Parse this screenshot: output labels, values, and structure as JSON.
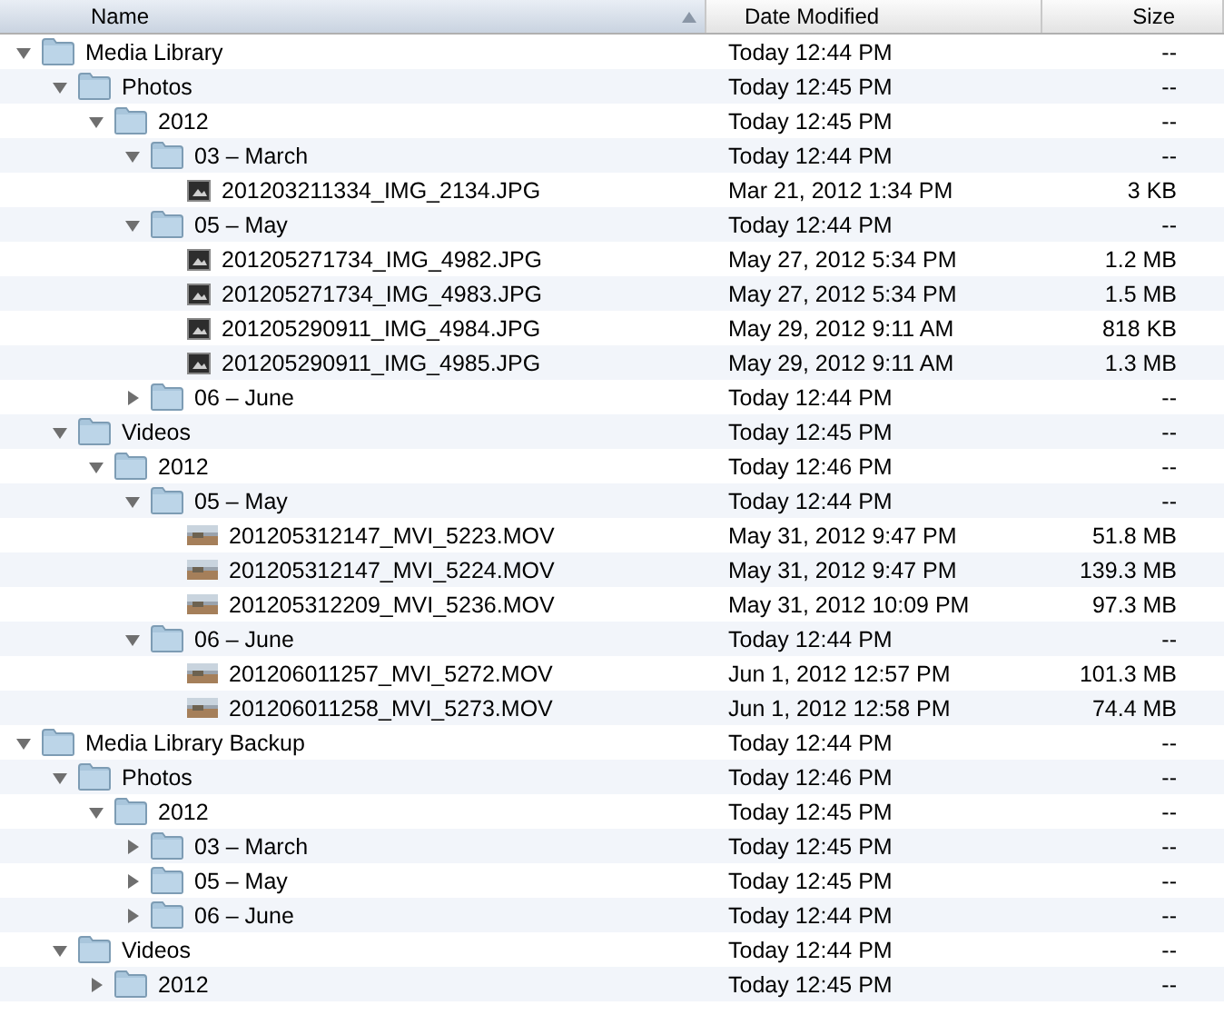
{
  "columns": [
    {
      "label": "Name",
      "selected": true,
      "sort_ascending": true
    },
    {
      "label": "Date Modified",
      "selected": false
    },
    {
      "label": "Size",
      "selected": false
    }
  ],
  "items": [
    {
      "name": "Media Library",
      "kind": "folder",
      "date": "Today 12:44 PM",
      "size": "--",
      "expanded": true,
      "children": [
        {
          "name": "Photos",
          "kind": "folder",
          "date": "Today 12:45 PM",
          "size": "--",
          "expanded": true,
          "children": [
            {
              "name": "2012",
              "kind": "folder",
              "date": "Today 12:45 PM",
              "size": "--",
              "expanded": true,
              "children": [
                {
                  "name": "03 – March",
                  "kind": "folder",
                  "date": "Today 12:44 PM",
                  "size": "--",
                  "expanded": true,
                  "children": [
                    {
                      "name": "201203211334_IMG_2134.JPG",
                      "kind": "image",
                      "date": "Mar 21, 2012 1:34 PM",
                      "size": "3 KB"
                    }
                  ]
                },
                {
                  "name": "05 – May",
                  "kind": "folder",
                  "date": "Today 12:44 PM",
                  "size": "--",
                  "expanded": true,
                  "children": [
                    {
                      "name": "201205271734_IMG_4982.JPG",
                      "kind": "image",
                      "date": "May 27, 2012 5:34 PM",
                      "size": "1.2 MB"
                    },
                    {
                      "name": "201205271734_IMG_4983.JPG",
                      "kind": "image",
                      "date": "May 27, 2012 5:34 PM",
                      "size": "1.5 MB"
                    },
                    {
                      "name": "201205290911_IMG_4984.JPG",
                      "kind": "image",
                      "date": "May 29, 2012 9:11 AM",
                      "size": "818 KB"
                    },
                    {
                      "name": "201205290911_IMG_4985.JPG",
                      "kind": "image",
                      "date": "May 29, 2012 9:11 AM",
                      "size": "1.3 MB"
                    }
                  ]
                },
                {
                  "name": "06 – June",
                  "kind": "folder",
                  "date": "Today 12:44 PM",
                  "size": "--",
                  "expanded": false
                }
              ]
            }
          ]
        },
        {
          "name": "Videos",
          "kind": "folder",
          "date": "Today 12:45 PM",
          "size": "--",
          "expanded": true,
          "children": [
            {
              "name": "2012",
              "kind": "folder",
              "date": "Today 12:46 PM",
              "size": "--",
              "expanded": true,
              "children": [
                {
                  "name": "05 – May",
                  "kind": "folder",
                  "date": "Today 12:44 PM",
                  "size": "--",
                  "expanded": true,
                  "children": [
                    {
                      "name": "201205312147_MVI_5223.MOV",
                      "kind": "video",
                      "date": "May 31, 2012 9:47 PM",
                      "size": "51.8 MB"
                    },
                    {
                      "name": "201205312147_MVI_5224.MOV",
                      "kind": "video",
                      "date": "May 31, 2012 9:47 PM",
                      "size": "139.3 MB"
                    },
                    {
                      "name": "201205312209_MVI_5236.MOV",
                      "kind": "video",
                      "date": "May 31, 2012 10:09 PM",
                      "size": "97.3 MB"
                    }
                  ]
                },
                {
                  "name": "06 – June",
                  "kind": "folder",
                  "date": "Today 12:44 PM",
                  "size": "--",
                  "expanded": true,
                  "children": [
                    {
                      "name": "201206011257_MVI_5272.MOV",
                      "kind": "video",
                      "date": "Jun 1, 2012 12:57 PM",
                      "size": "101.3 MB"
                    },
                    {
                      "name": "201206011258_MVI_5273.MOV",
                      "kind": "video",
                      "date": "Jun 1, 2012 12:58 PM",
                      "size": "74.4 MB"
                    }
                  ]
                }
              ]
            }
          ]
        }
      ]
    },
    {
      "name": "Media Library Backup",
      "kind": "folder",
      "date": "Today 12:44 PM",
      "size": "--",
      "expanded": true,
      "children": [
        {
          "name": "Photos",
          "kind": "folder",
          "date": "Today 12:46 PM",
          "size": "--",
          "expanded": true,
          "children": [
            {
              "name": "2012",
              "kind": "folder",
              "date": "Today 12:45 PM",
              "size": "--",
              "expanded": true,
              "children": [
                {
                  "name": "03 – March",
                  "kind": "folder",
                  "date": "Today 12:45 PM",
                  "size": "--",
                  "expanded": false
                },
                {
                  "name": "05 – May",
                  "kind": "folder",
                  "date": "Today 12:45 PM",
                  "size": "--",
                  "expanded": false
                },
                {
                  "name": "06 – June",
                  "kind": "folder",
                  "date": "Today 12:44 PM",
                  "size": "--",
                  "expanded": false
                }
              ]
            }
          ]
        },
        {
          "name": "Videos",
          "kind": "folder",
          "date": "Today 12:44 PM",
          "size": "--",
          "expanded": true,
          "children": [
            {
              "name": "2012",
              "kind": "folder",
              "date": "Today 12:45 PM",
              "size": "--",
              "expanded": false
            }
          ]
        }
      ]
    }
  ]
}
